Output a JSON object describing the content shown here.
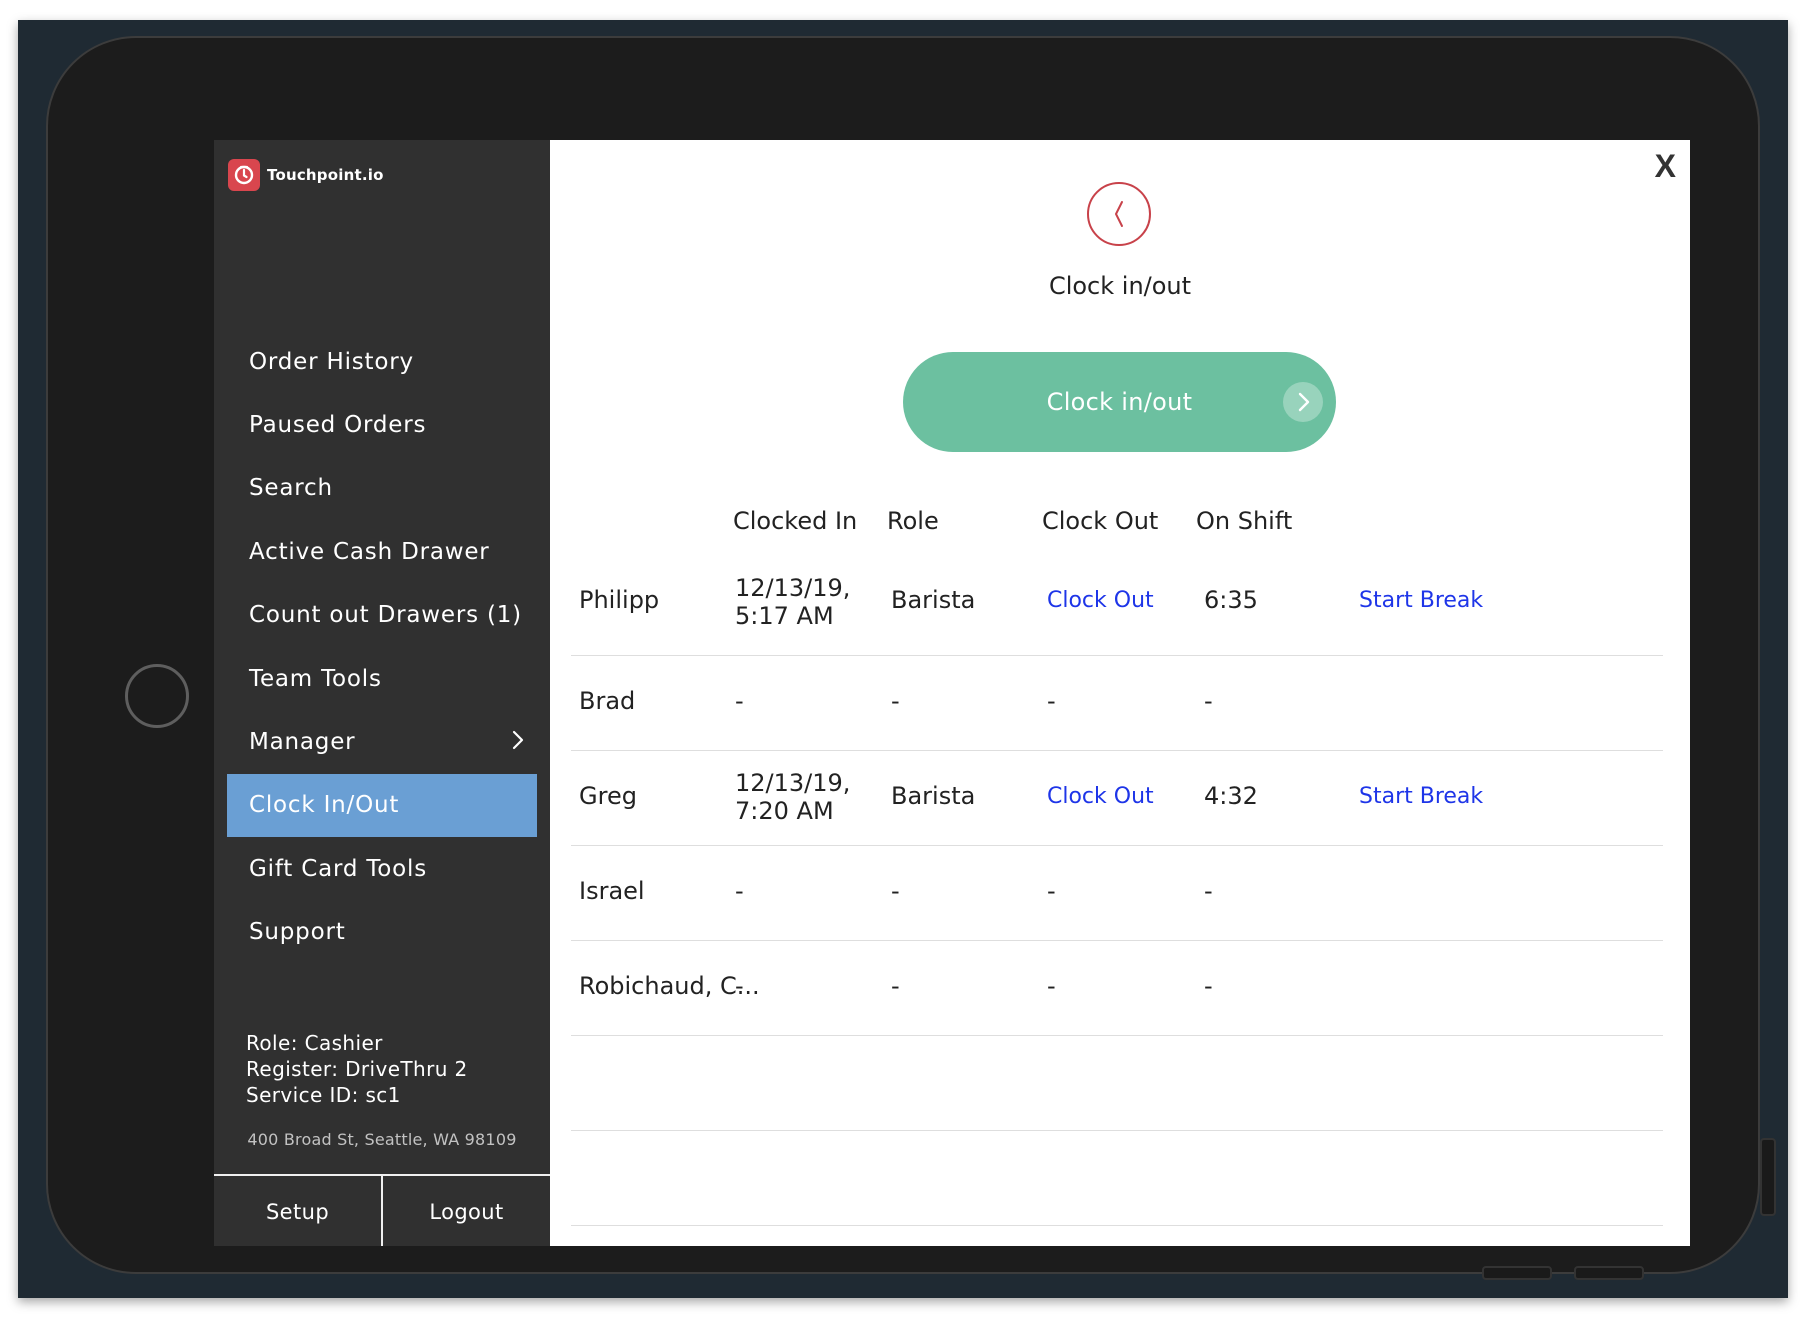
{
  "brand": {
    "name": "Touchpoint.io",
    "logo_color": "#d9464e"
  },
  "sidebar": {
    "items": [
      {
        "label": "Order History"
      },
      {
        "label": "Paused Orders"
      },
      {
        "label": "Search"
      },
      {
        "label": "Active Cash Drawer"
      },
      {
        "label": "Count out Drawers (1)"
      },
      {
        "label": "Team Tools"
      },
      {
        "label": "Manager",
        "has_submenu": true
      },
      {
        "label": "Clock In/Out",
        "active": true
      },
      {
        "label": "Gift Card Tools"
      },
      {
        "label": "Support"
      }
    ],
    "info": {
      "role": "Role: Cashier",
      "register": "Register: DriveThru 2",
      "service": "Service ID: sc1"
    },
    "address": "400 Broad St, Seattle, WA 98109",
    "footer": {
      "setup": "Setup",
      "logout": "Logout"
    },
    "active_color": "#6a9fd4"
  },
  "main": {
    "close_label": "X",
    "icon": "clock-icon",
    "title": "Clock in/out",
    "button": {
      "label": "Clock in/out",
      "color": "#6cc0a0",
      "icon": "chevron-right-icon"
    },
    "table": {
      "headers": {
        "clocked_in": "Clocked In",
        "role": "Role",
        "clock_out": "Clock Out",
        "on_shift": "On Shift"
      },
      "rows": [
        {
          "name": "Philipp",
          "clocked_in_date": "12/13/19,",
          "clocked_in_time": "5:17 AM",
          "role": "Barista",
          "clock_out": "Clock Out",
          "on_shift": "6:35",
          "action": "Start Break"
        },
        {
          "name": "Brad",
          "clocked_in": "-",
          "role": "-",
          "clock_out": "-",
          "on_shift": "-"
        },
        {
          "name": "Greg",
          "clocked_in_date": "12/13/19,",
          "clocked_in_time": "7:20 AM",
          "role": "Barista",
          "clock_out": "Clock Out",
          "on_shift": "4:32",
          "action": "Start Break"
        },
        {
          "name": "Israel",
          "clocked_in": "-",
          "role": "-",
          "clock_out": "-",
          "on_shift": "-"
        },
        {
          "name": "Robichaud, C...",
          "clocked_in": "-",
          "role": "-",
          "clock_out": "-",
          "on_shift": "-"
        }
      ],
      "link_color": "#1e35e8"
    }
  }
}
